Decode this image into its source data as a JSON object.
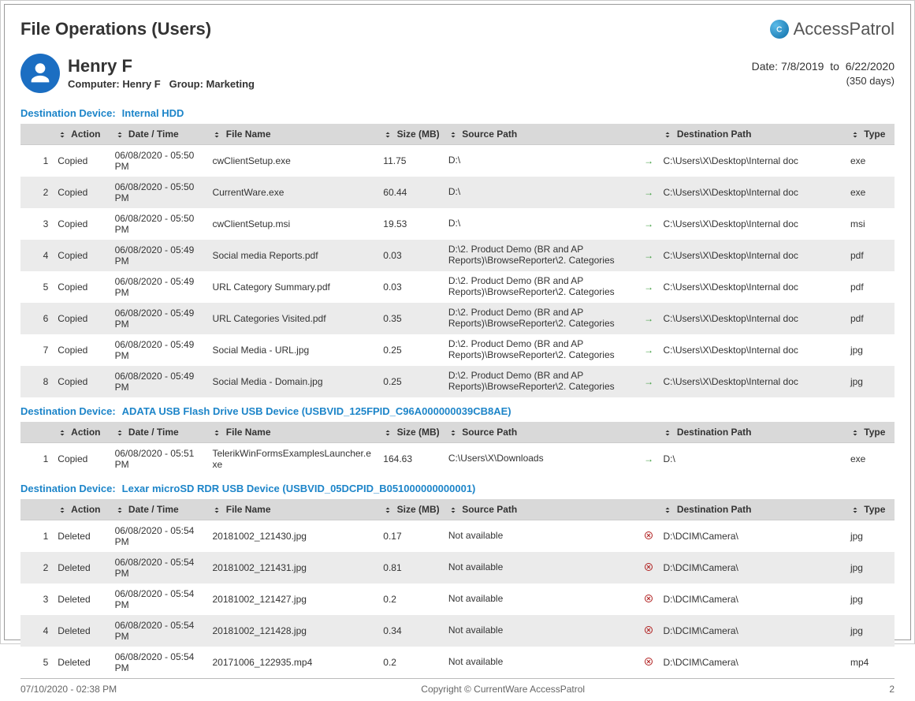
{
  "header": {
    "title": "File Operations (Users)",
    "brand": "AccessPatrol"
  },
  "user": {
    "name": "Henry F",
    "computer_label": "Computer:",
    "computer": "Henry F",
    "group_label": "Group:",
    "group": "Marketing"
  },
  "date_range": {
    "prefix": "Date:",
    "from": "7/8/2019",
    "sep": "to",
    "to": "6/22/2020",
    "days": "(350 days)"
  },
  "labels": {
    "destination_device": "Destination Device:"
  },
  "columns": {
    "action": "Action",
    "datetime": "Date / Time",
    "filename": "File Name",
    "size": "Size (MB)",
    "source": "Source Path",
    "destination": "Destination Path",
    "type": "Type"
  },
  "sections": [
    {
      "device": "Internal HDD",
      "rows": [
        {
          "idx": "1",
          "action": "Copied",
          "dt": "06/08/2020 - 05:50 PM",
          "fn": "cwClientSetup.exe",
          "size": "11.75",
          "src": "D:\\",
          "arrowKind": "arrow",
          "dest": "C:\\Users\\X\\Desktop\\Internal doc",
          "type": "exe"
        },
        {
          "idx": "2",
          "action": "Copied",
          "dt": "06/08/2020 - 05:50 PM",
          "fn": "CurrentWare.exe",
          "size": "60.44",
          "src": "D:\\",
          "arrowKind": "arrow",
          "dest": "C:\\Users\\X\\Desktop\\Internal doc",
          "type": "exe"
        },
        {
          "idx": "3",
          "action": "Copied",
          "dt": "06/08/2020 - 05:50 PM",
          "fn": "cwClientSetup.msi",
          "size": "19.53",
          "src": "D:\\",
          "arrowKind": "arrow",
          "dest": "C:\\Users\\X\\Desktop\\Internal doc",
          "type": "msi"
        },
        {
          "idx": "4",
          "action": "Copied",
          "dt": "06/08/2020 - 05:49 PM",
          "fn": "Social media Reports.pdf",
          "size": "0.03",
          "src": "D:\\2. Product Demo (BR and AP Reports)\\BrowseReporter\\2. Categories",
          "arrowKind": "arrow",
          "dest": "C:\\Users\\X\\Desktop\\Internal doc",
          "type": "pdf"
        },
        {
          "idx": "5",
          "action": "Copied",
          "dt": "06/08/2020 - 05:49 PM",
          "fn": "URL Category Summary.pdf",
          "size": "0.03",
          "src": "D:\\2. Product Demo (BR and AP Reports)\\BrowseReporter\\2. Categories",
          "arrowKind": "arrow",
          "dest": "C:\\Users\\X\\Desktop\\Internal doc",
          "type": "pdf"
        },
        {
          "idx": "6",
          "action": "Copied",
          "dt": "06/08/2020 - 05:49 PM",
          "fn": "URL Categories Visited.pdf",
          "size": "0.35",
          "src": "D:\\2. Product Demo (BR and AP Reports)\\BrowseReporter\\2. Categories",
          "arrowKind": "arrow",
          "dest": "C:\\Users\\X\\Desktop\\Internal doc",
          "type": "pdf"
        },
        {
          "idx": "7",
          "action": "Copied",
          "dt": "06/08/2020 - 05:49 PM",
          "fn": "Social Media - URL.jpg",
          "size": "0.25",
          "src": "D:\\2. Product Demo (BR and AP Reports)\\BrowseReporter\\2. Categories",
          "arrowKind": "arrow",
          "dest": "C:\\Users\\X\\Desktop\\Internal doc",
          "type": "jpg"
        },
        {
          "idx": "8",
          "action": "Copied",
          "dt": "06/08/2020 - 05:49 PM",
          "fn": "Social Media - Domain.jpg",
          "size": "0.25",
          "src": "D:\\2. Product Demo (BR and AP Reports)\\BrowseReporter\\2. Categories",
          "arrowKind": "arrow",
          "dest": "C:\\Users\\X\\Desktop\\Internal doc",
          "type": "jpg"
        }
      ]
    },
    {
      "device": "ADATA USB Flash Drive USB Device (USBVID_125FPID_C96A000000039CB8AE)",
      "rows": [
        {
          "idx": "1",
          "action": "Copied",
          "dt": "06/08/2020 - 05:51 PM",
          "fn": "TelerikWinFormsExamplesLauncher.exe",
          "size": "164.63",
          "src": "C:\\Users\\X\\Downloads",
          "arrowKind": "arrow",
          "dest": "D:\\",
          "type": "exe"
        }
      ]
    },
    {
      "device": "Lexar microSD RDR USB Device (USBVID_05DCPID_B051000000000001)",
      "rows": [
        {
          "idx": "1",
          "action": "Deleted",
          "dt": "06/08/2020 - 05:54 PM",
          "fn": "20181002_121430.jpg",
          "size": "0.17",
          "src": "Not available",
          "arrowKind": "delete",
          "dest": "D:\\DCIM\\Camera\\",
          "type": "jpg"
        },
        {
          "idx": "2",
          "action": "Deleted",
          "dt": "06/08/2020 - 05:54 PM",
          "fn": "20181002_121431.jpg",
          "size": "0.81",
          "src": "Not available",
          "arrowKind": "delete",
          "dest": "D:\\DCIM\\Camera\\",
          "type": "jpg"
        },
        {
          "idx": "3",
          "action": "Deleted",
          "dt": "06/08/2020 - 05:54 PM",
          "fn": "20181002_121427.jpg",
          "size": "0.2",
          "src": "Not available",
          "arrowKind": "delete",
          "dest": "D:\\DCIM\\Camera\\",
          "type": "jpg"
        },
        {
          "idx": "4",
          "action": "Deleted",
          "dt": "06/08/2020 - 05:54 PM",
          "fn": "20181002_121428.jpg",
          "size": "0.34",
          "src": "Not available",
          "arrowKind": "delete",
          "dest": "D:\\DCIM\\Camera\\",
          "type": "jpg"
        },
        {
          "idx": "5",
          "action": "Deleted",
          "dt": "06/08/2020 - 05:54 PM",
          "fn": "20171006_122935.mp4",
          "size": "0.2",
          "src": "Not available",
          "arrowKind": "delete",
          "dest": "D:\\DCIM\\Camera\\",
          "type": "mp4"
        }
      ]
    }
  ],
  "footer": {
    "timestamp": "07/10/2020 - 02:38 PM",
    "copyright": "Copyright © CurrentWare AccessPatrol",
    "page": "2"
  }
}
